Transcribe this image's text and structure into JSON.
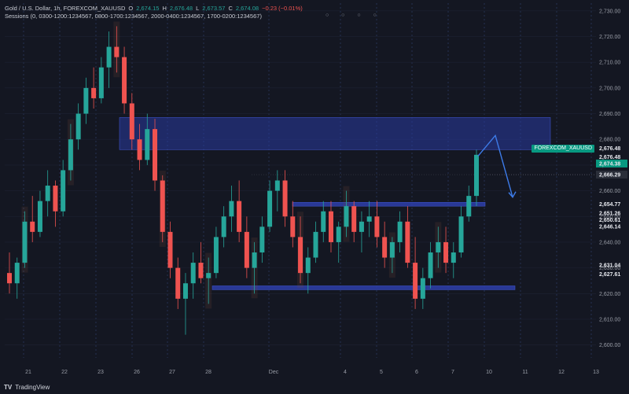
{
  "legend": {
    "title": "Gold / U.S. Dollar, 1h, FOREXCOM_XAUUSD",
    "o_label": "O",
    "o_value": "2,674.15",
    "h_label": "H",
    "h_value": "2,676.48",
    "l_label": "L",
    "l_value": "2,673.57",
    "c_label": "C",
    "c_value": "2,674.08",
    "change": "−0.23 (−0.01%)",
    "sessions": "Sessions (0, 0300-1200:1234567, 0800-1700:1234567, 2000-0400:1234567, 1700-0200:1234567)",
    "circles": "○ ○ ○ ○"
  },
  "branding": {
    "logo_mark": "TV",
    "logo_text": "TradingView"
  },
  "symbol_tag": "FOREXCOM_XAUUSD",
  "chart_data": {
    "type": "candlestick",
    "title": "Gold / U.S. Dollar, 1h, FOREXCOM_XAUUSD",
    "ylim": [
      2595,
      2733
    ],
    "y_ticks": [
      2600,
      2610,
      2620,
      2630,
      2640,
      2650,
      2660,
      2670,
      2680,
      2690,
      2700,
      2710,
      2720,
      2730
    ],
    "y_tick_labels": [
      "2,600.00",
      "2,610.00",
      "2,620.00",
      "2,630.00",
      "2,640.00",
      "2,650.00",
      "2,660.00",
      "2,670.00",
      "2,680.00",
      "2,690.00",
      "2,700.00",
      "2,710.00",
      "2,720.00",
      "2,730.00"
    ],
    "x_labels": [
      "21",
      "22",
      "23",
      "26",
      "27",
      "28",
      "Dec",
      "4",
      "5",
      "6",
      "7",
      "10",
      "11",
      "12",
      "13"
    ],
    "highlighted_prices": [
      {
        "label": "2,676.48",
        "value": 2676.48,
        "bg": "none"
      },
      {
        "label": "2,676.48",
        "value": 2673.2,
        "bg": "none"
      },
      {
        "label": "2,674.38",
        "value": 2670.6,
        "bg": "#089981"
      },
      {
        "label": "2,666.29",
        "value": 2666.29,
        "bg": "#2a2e39"
      },
      {
        "label": "2,654.77",
        "value": 2654.77,
        "bg": "none"
      },
      {
        "label": "2,651.26",
        "value": 2651.26,
        "bg": "none"
      },
      {
        "label": "2,650.61",
        "value": 2648.7,
        "bg": "none"
      },
      {
        "label": "2,646.14",
        "value": 2646.14,
        "bg": "none"
      },
      {
        "label": "2,631.04",
        "value": 2631.04,
        "bg": "none"
      },
      {
        "label": "2,627.61",
        "value": 2627.61,
        "bg": "none"
      }
    ],
    "zones": [
      {
        "name": "supply-zone",
        "from": 2676.0,
        "to": 2688.5,
        "x_from": "23",
        "x_to": "10"
      },
      {
        "name": "range-top",
        "from": 2654.0,
        "to": 2655.5,
        "x_from": "28",
        "x_to": "7"
      },
      {
        "name": "range-bottom",
        "from": 2621.5,
        "to": 2623.0,
        "x_from": "27",
        "x_to": "10"
      }
    ],
    "projection": [
      [
        2673.5,
        0
      ],
      [
        2681.5,
        1
      ],
      [
        2657.5,
        2
      ]
    ],
    "candles": [
      [
        2628,
        2636,
        2620,
        2624
      ],
      [
        2624,
        2634,
        2618,
        2632
      ],
      [
        2632,
        2652,
        2630,
        2648
      ],
      [
        2648,
        2658,
        2640,
        2644
      ],
      [
        2644,
        2660,
        2642,
        2656
      ],
      [
        2656,
        2668,
        2650,
        2662
      ],
      [
        2662,
        2664,
        2646,
        2652
      ],
      [
        2652,
        2672,
        2650,
        2668
      ],
      [
        2668,
        2686,
        2664,
        2680
      ],
      [
        2680,
        2694,
        2676,
        2690
      ],
      [
        2690,
        2704,
        2686,
        2700
      ],
      [
        2700,
        2708,
        2692,
        2696
      ],
      [
        2696,
        2712,
        2694,
        2708
      ],
      [
        2708,
        2722,
        2700,
        2716
      ],
      [
        2716,
        2724,
        2706,
        2712
      ],
      [
        2712,
        2716,
        2690,
        2694
      ],
      [
        2694,
        2698,
        2676,
        2680
      ],
      [
        2680,
        2686,
        2668,
        2672
      ],
      [
        2672,
        2690,
        2670,
        2684
      ],
      [
        2684,
        2688,
        2660,
        2664
      ],
      [
        2664,
        2666,
        2640,
        2644
      ],
      [
        2644,
        2648,
        2626,
        2630
      ],
      [
        2630,
        2634,
        2614,
        2618
      ],
      [
        2618,
        2628,
        2604,
        2624
      ],
      [
        2624,
        2636,
        2618,
        2632
      ],
      [
        2632,
        2640,
        2624,
        2626
      ],
      [
        2626,
        2634,
        2616,
        2628
      ],
      [
        2628,
        2646,
        2626,
        2642
      ],
      [
        2642,
        2654,
        2638,
        2650
      ],
      [
        2650,
        2662,
        2644,
        2656
      ],
      [
        2656,
        2664,
        2640,
        2644
      ],
      [
        2644,
        2650,
        2626,
        2630
      ],
      [
        2630,
        2640,
        2620,
        2636
      ],
      [
        2636,
        2650,
        2632,
        2646
      ],
      [
        2646,
        2664,
        2644,
        2660
      ],
      [
        2660,
        2668,
        2652,
        2664
      ],
      [
        2664,
        2668,
        2646,
        2650
      ],
      [
        2650,
        2656,
        2638,
        2642
      ],
      [
        2642,
        2650,
        2624,
        2628
      ],
      [
        2628,
        2638,
        2620,
        2634
      ],
      [
        2634,
        2648,
        2632,
        2644
      ],
      [
        2644,
        2656,
        2640,
        2652
      ],
      [
        2652,
        2656,
        2636,
        2640
      ],
      [
        2640,
        2648,
        2632,
        2646
      ],
      [
        2646,
        2660,
        2642,
        2654
      ],
      [
        2654,
        2656,
        2640,
        2644
      ],
      [
        2644,
        2652,
        2636,
        2648
      ],
      [
        2648,
        2656,
        2642,
        2650
      ],
      [
        2650,
        2656,
        2638,
        2642
      ],
      [
        2642,
        2648,
        2630,
        2634
      ],
      [
        2634,
        2642,
        2628,
        2640
      ],
      [
        2640,
        2652,
        2636,
        2648
      ],
      [
        2648,
        2654,
        2630,
        2632
      ],
      [
        2632,
        2642,
        2614,
        2618
      ],
      [
        2618,
        2630,
        2614,
        2626
      ],
      [
        2626,
        2640,
        2622,
        2636
      ],
      [
        2636,
        2646,
        2630,
        2640
      ],
      [
        2640,
        2646,
        2628,
        2632
      ],
      [
        2632,
        2640,
        2626,
        2636
      ],
      [
        2636,
        2654,
        2634,
        2650
      ],
      [
        2650,
        2662,
        2648,
        2658
      ],
      [
        2658,
        2676,
        2654,
        2674
      ]
    ]
  }
}
